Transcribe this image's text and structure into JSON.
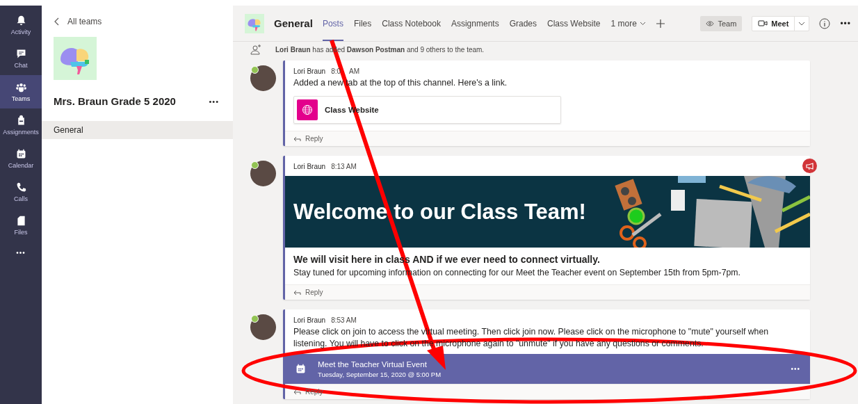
{
  "app_bar": [
    {
      "label": "Activity",
      "selected": false
    },
    {
      "label": "Chat",
      "selected": false
    },
    {
      "label": "Teams",
      "selected": true
    },
    {
      "label": "Assignments",
      "selected": false
    },
    {
      "label": "Calendar",
      "selected": false
    },
    {
      "label": "Calls",
      "selected": false
    },
    {
      "label": "Files",
      "selected": false
    }
  ],
  "app_bar_more": "•••",
  "team_panel": {
    "back": "All teams",
    "team_name": "Mrs. Braun Grade 5 2020",
    "more": "•••",
    "channels": [
      {
        "name": "General",
        "selected": true
      }
    ]
  },
  "channel_header": {
    "name": "General",
    "tabs": [
      {
        "label": "Posts",
        "selected": true,
        "kind": "tab"
      },
      {
        "label": "Files",
        "selected": false,
        "kind": "tab"
      },
      {
        "label": "Class Notebook",
        "selected": false,
        "kind": "tab"
      },
      {
        "label": "Assignments",
        "selected": false,
        "kind": "tab"
      },
      {
        "label": "Grades",
        "selected": false,
        "kind": "tab"
      },
      {
        "label": "Class Website",
        "selected": false,
        "kind": "tab"
      },
      {
        "label": "1 more",
        "selected": false,
        "kind": "dropdown"
      }
    ],
    "team_button": "Team",
    "meet_button": "Meet",
    "more": "•••"
  },
  "system_message": "**Lori Braun** has added **Dawson Postman** and 9 others to the team.",
  "posts": [
    {
      "kind": "link",
      "author": "Lori Braun",
      "time": "8:0",
      "time_suffix": "AM",
      "body": "Added a new tab at the top of this channel. Here's a link.",
      "card_title": "Class Website",
      "reply": "Reply"
    },
    {
      "kind": "announcement",
      "author": "Lori Braun",
      "time": "8:13 AM",
      "banner_title": "Welcome to our Class Team!",
      "subtitle": "We will visit here in class AND if we ever need to connect virtually.",
      "body": "Stay tuned for upcoming information on connecting for our Meet the Teacher event on September 15th from 5pm-7pm.",
      "reply": "Reply"
    },
    {
      "kind": "meeting",
      "author": "Lori Braun",
      "time": "8:53 AM",
      "body": "Please click on join to access the virtual meeting. Then click join now. Please click on the microphone to \"mute\" yourself when listening. You will have to click on the microphone again to \"unmute\" if you have any questions or comments.",
      "meeting_title": "Meet the Teacher Virtual Event",
      "meeting_when": "Tuesday, September 15, 2020 @ 5:00 PM",
      "meeting_more": "•••",
      "reply": "Reply"
    }
  ],
  "annotations": {
    "arrow": true,
    "ellipse": true
  }
}
